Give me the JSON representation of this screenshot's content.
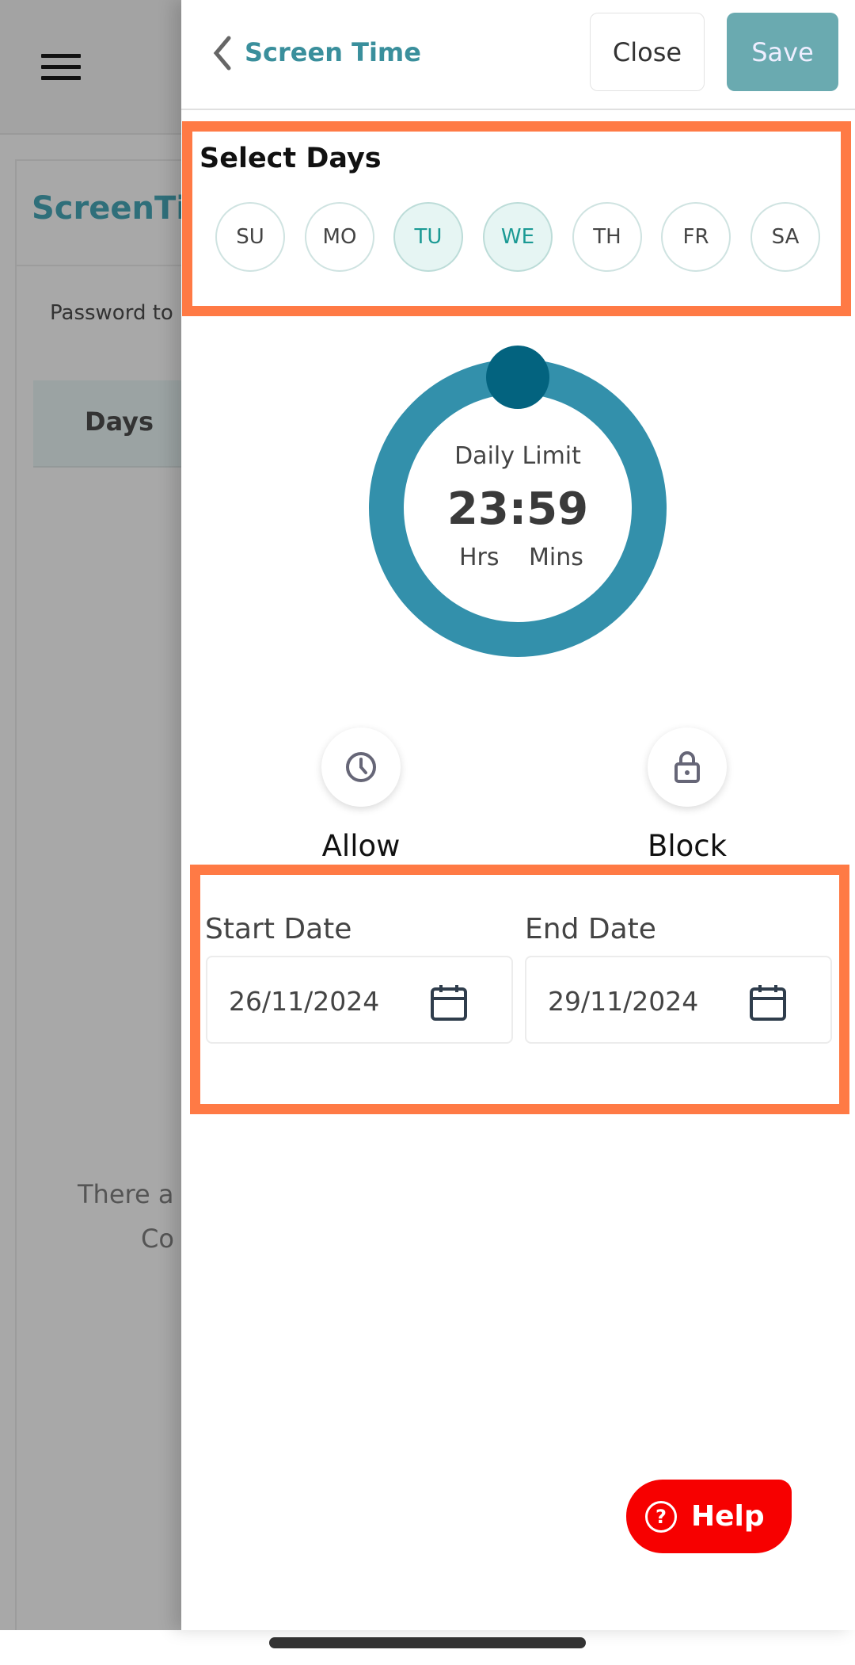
{
  "background": {
    "page_title_partial": "ScreenTi",
    "password_text_partial": "Password to",
    "table_header_days": "Days",
    "empty_message_line1_partial": "There a",
    "empty_message_line2_partial": "Co"
  },
  "drawer": {
    "title": "Screen Time",
    "close_label": "Close",
    "save_label": "Save",
    "select_days_title": "Select Days",
    "days": [
      {
        "label": "SU",
        "selected": false
      },
      {
        "label": "MO",
        "selected": false
      },
      {
        "label": "TU",
        "selected": true
      },
      {
        "label": "WE",
        "selected": true
      },
      {
        "label": "TH",
        "selected": false
      },
      {
        "label": "FR",
        "selected": false
      },
      {
        "label": "SA",
        "selected": false
      }
    ],
    "daily_limit": {
      "label": "Daily Limit",
      "value": "23:59",
      "hours_label": "Hrs",
      "minutes_label": "Mins"
    },
    "allow_label": "Allow",
    "block_label": "Block",
    "start_date_label": "Start Date",
    "start_date_value": "26/11/2024",
    "end_date_label": "End Date",
    "end_date_value": "29/11/2024",
    "help_label": "Help"
  },
  "colors": {
    "accent": "#3390ab",
    "knob": "#03637f",
    "highlight": "#ff7a45",
    "help": "#f70000",
    "save": "#6aaab0"
  }
}
